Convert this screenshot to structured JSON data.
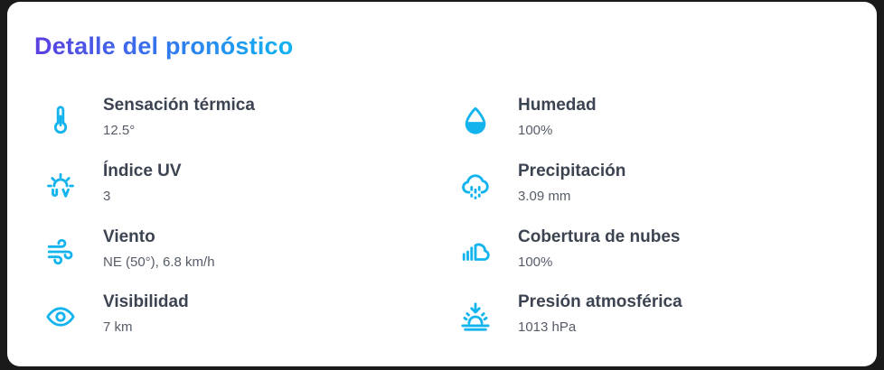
{
  "title": "Detalle del pronóstico",
  "colors": {
    "icon": "#13b4ee",
    "label": "#3d4451",
    "value": "#555c68",
    "title_gradient": [
      "#5b3fe0",
      "#2f7df0",
      "#10b4f2"
    ]
  },
  "details": {
    "left": [
      {
        "icon": "thermometer-icon",
        "label": "Sensación térmica",
        "value": "12.5°"
      },
      {
        "icon": "uv-index-icon",
        "label": "Índice UV",
        "value": "3"
      },
      {
        "icon": "wind-icon",
        "label": "Viento",
        "value": "NE (50°), 6.8 km/h"
      },
      {
        "icon": "eye-icon",
        "label": "Visibilidad",
        "value": "7 km"
      }
    ],
    "right": [
      {
        "icon": "droplet-icon",
        "label": "Humedad",
        "value": "100%"
      },
      {
        "icon": "cloud-rain-icon",
        "label": "Precipitación",
        "value": "3.09 mm"
      },
      {
        "icon": "cloud-cover-icon",
        "label": "Cobertura de nubes",
        "value": "100%"
      },
      {
        "icon": "pressure-icon",
        "label": "Presión atmosférica",
        "value": "1013 hPa"
      }
    ]
  }
}
